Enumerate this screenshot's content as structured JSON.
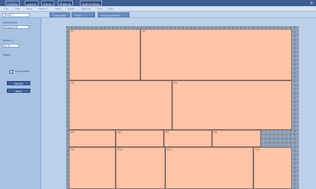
{
  "topbar": {
    "tabs": [
      "Cutting",
      "Layout",
      "Report",
      "Material",
      "Optimization"
    ]
  },
  "menubar": {
    "items": [
      "File",
      "Edit",
      "View",
      "Pattern",
      "Parts",
      "Stock",
      "Options",
      "Run",
      "Help"
    ]
  },
  "toolbar": {
    "lot_value": "Sheet 1",
    "buttons": [
      "Calculate",
      "Print",
      "Export pattern"
    ]
  },
  "sidebar": {
    "label1": "Stock sheet",
    "field1": "Plywood 18",
    "label2": "Pattern 1",
    "field2": "1 / 3",
    "label3": "Waste",
    "check_label": "Show labels",
    "button1": "Options",
    "button2": "Apply"
  },
  "pieces": {
    "p1": "P1",
    "p2": "P2",
    "p3": "P3",
    "p4": "P4",
    "p5": "P5",
    "p6": "P6",
    "p7": "P7",
    "p8": "P8",
    "p9": "P9",
    "p10": "P10",
    "p11": "P11",
    "p12": "P12"
  },
  "colors": {
    "piece_fill": "#ffc3a8",
    "waste_fill": "#8c9db4",
    "accent": "#3f63a5"
  }
}
